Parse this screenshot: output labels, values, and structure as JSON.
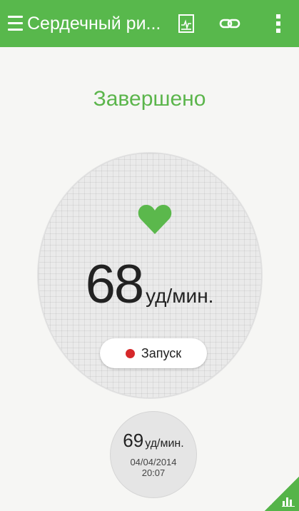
{
  "header": {
    "title": "Сердечный ри...",
    "menu_icon": "menu-icon",
    "history_icon": "history-icon",
    "link_icon": "link-icon",
    "more_icon": "more-vert-icon"
  },
  "status": "Завершено",
  "measurement": {
    "value": "68",
    "unit": "уд/мин."
  },
  "start_button": {
    "label": "Запуск"
  },
  "history": {
    "value": "69",
    "unit": "уд/мин.",
    "date": "04/04/2014",
    "time": "20:07"
  },
  "colors": {
    "accent": "#58b84c",
    "record": "#d6282a"
  }
}
